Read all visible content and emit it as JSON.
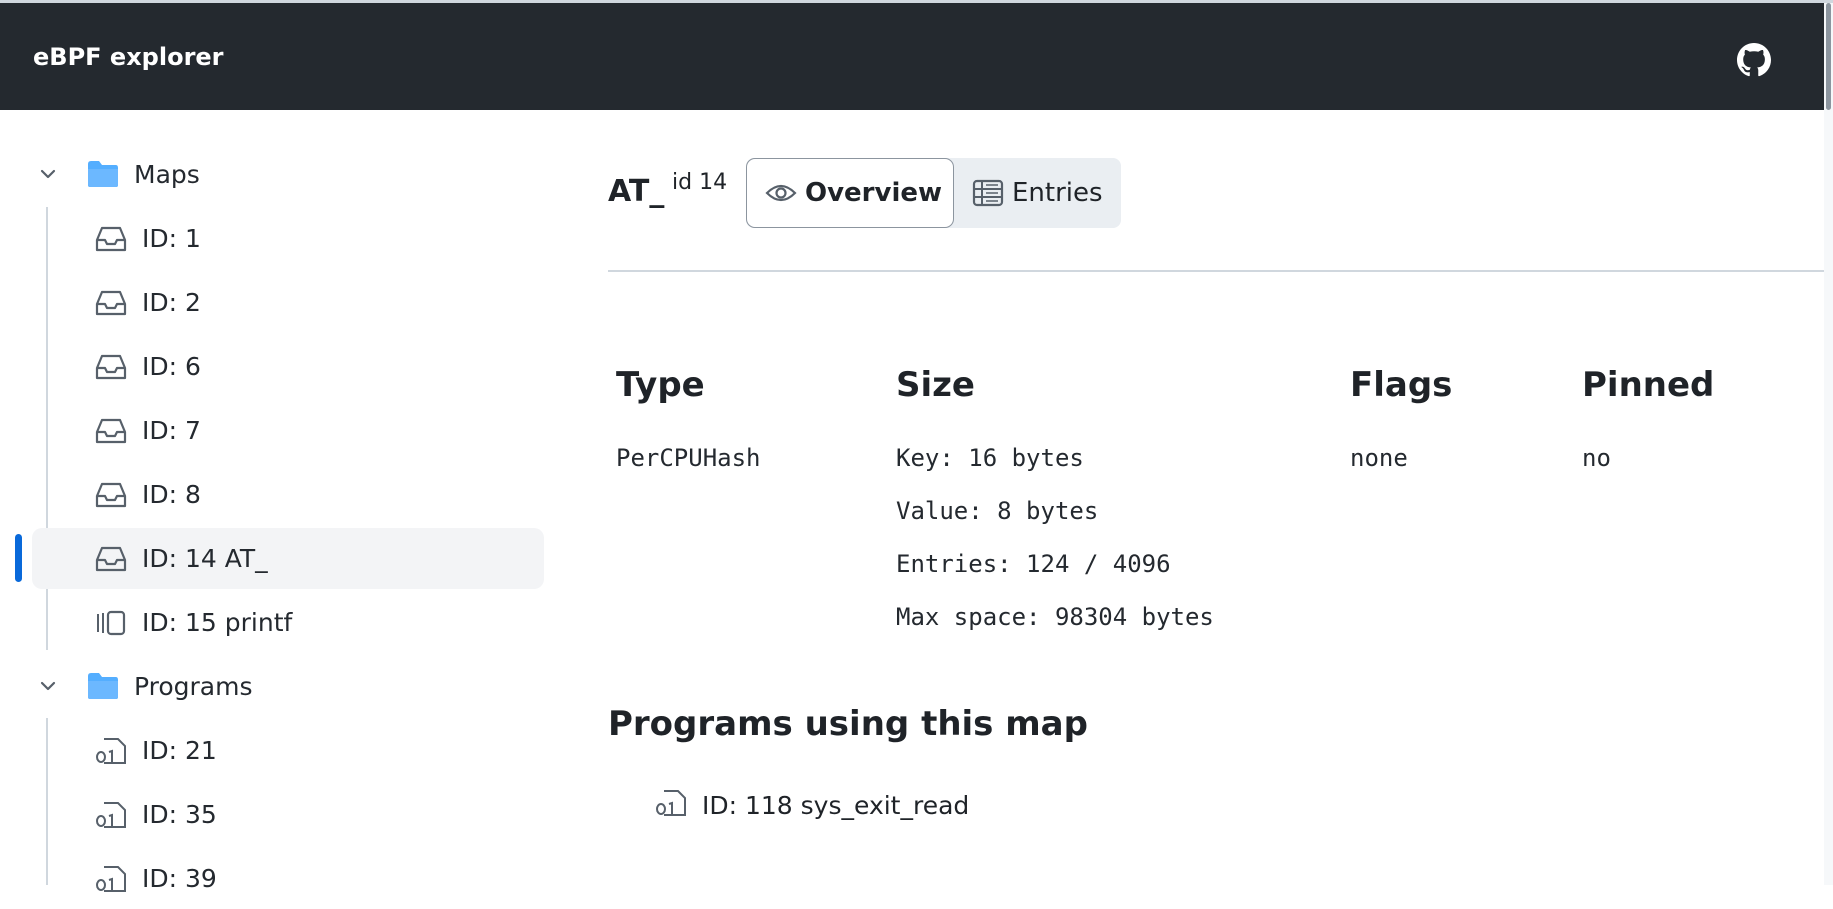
{
  "header": {
    "title": "eBPF explorer",
    "github_icon": "github-icon"
  },
  "sidebar": {
    "maps": {
      "label": "Maps",
      "items": [
        {
          "label": "ID: 1",
          "icon": "inbox-icon"
        },
        {
          "label": "ID: 2",
          "icon": "inbox-icon"
        },
        {
          "label": "ID: 6",
          "icon": "inbox-icon"
        },
        {
          "label": "ID: 7",
          "icon": "inbox-icon"
        },
        {
          "label": "ID: 8",
          "icon": "inbox-icon"
        },
        {
          "label": "ID: 14 AT_",
          "icon": "inbox-icon",
          "selected": true
        },
        {
          "label": "ID: 15 printf",
          "icon": "ringbuffer-icon"
        }
      ]
    },
    "programs": {
      "label": "Programs",
      "items": [
        {
          "label": "ID: 21",
          "icon": "binary-file-icon"
        },
        {
          "label": "ID: 35",
          "icon": "binary-file-icon"
        },
        {
          "label": "ID: 39",
          "icon": "binary-file-icon"
        }
      ]
    }
  },
  "main": {
    "title": "AT_",
    "id_label": "id 14",
    "tabs": [
      {
        "label": "Overview",
        "icon": "eye-icon",
        "active": true
      },
      {
        "label": "Entries",
        "icon": "table-icon",
        "active": false
      }
    ],
    "overview": {
      "type": {
        "heading": "Type",
        "values": [
          "PerCPUHash"
        ]
      },
      "size": {
        "heading": "Size",
        "values": [
          "Key: 16 bytes",
          "Value: 8 bytes",
          "Entries: 124 / 4096",
          "Max space: 98304 bytes"
        ]
      },
      "flags": {
        "heading": "Flags",
        "values": [
          "none"
        ]
      },
      "pinned": {
        "heading": "Pinned",
        "values": [
          "no"
        ]
      }
    },
    "programs_section": {
      "heading": "Programs using this map",
      "items": [
        {
          "label": "ID: 118 sys_exit_read",
          "icon": "binary-file-icon"
        }
      ]
    }
  },
  "colors": {
    "header_bg": "#24292f",
    "accent": "#0969da",
    "folder": "#54aeff",
    "selected_bg": "#f3f4f6"
  }
}
